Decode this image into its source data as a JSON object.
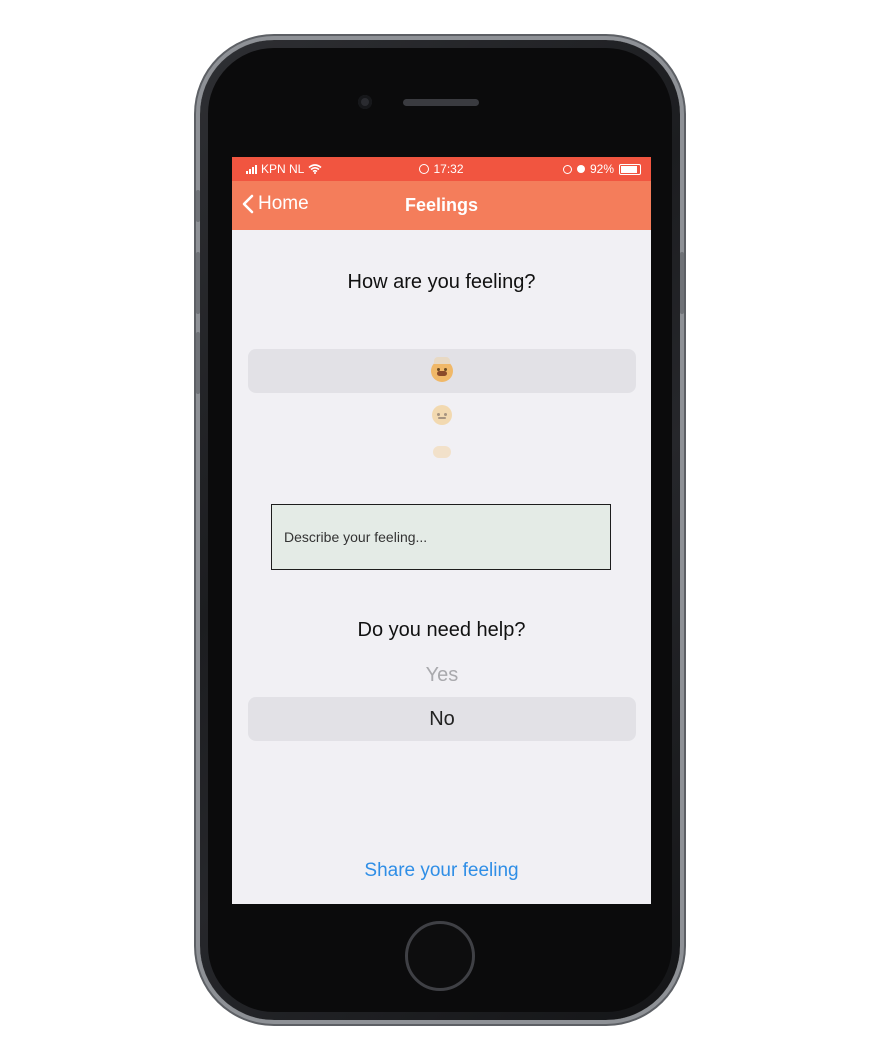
{
  "status_bar": {
    "carrier": "KPN NL",
    "time": "17:32",
    "battery": "92%"
  },
  "nav": {
    "back_label": "Home",
    "title": "Feelings"
  },
  "feeling": {
    "question": "How are you feeling?",
    "options": [
      "exploding-head-emoji",
      "neutral-face-emoji",
      "expressionless-face-emoji"
    ],
    "selected_index": 0
  },
  "describe": {
    "placeholder": "Describe your feeling..."
  },
  "help": {
    "question": "Do you need help?",
    "options": [
      "Yes",
      "No"
    ],
    "selected": "No"
  },
  "share_label": "Share your feeling",
  "colors": {
    "status_bar": "#f15540",
    "nav_bar": "#f47d5b",
    "link": "#2f8ee6",
    "screen_bg": "#f1f0f4"
  }
}
